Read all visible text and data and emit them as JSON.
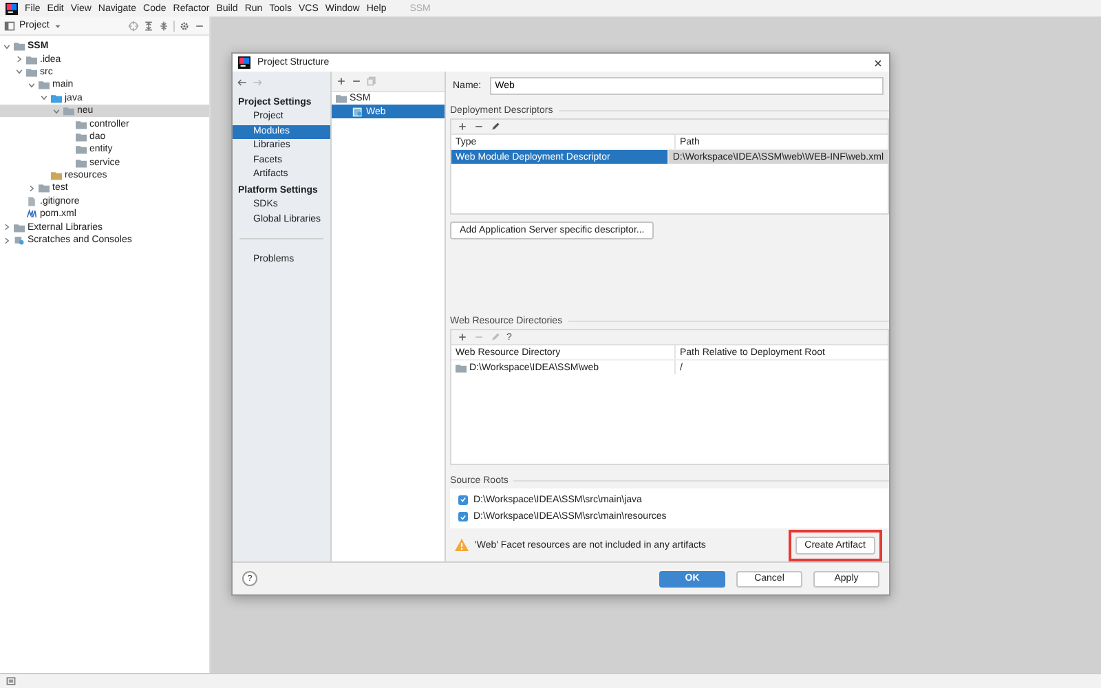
{
  "menu": [
    "File",
    "Edit",
    "View",
    "Navigate",
    "Code",
    "Refactor",
    "Build",
    "Run",
    "Tools",
    "VCS",
    "Window",
    "Help"
  ],
  "app_title": "SSM",
  "project_panel": {
    "title": "Project",
    "tree": [
      {
        "label": "SSM",
        "kind": "module",
        "bold": true,
        "expanded": true,
        "selected": false,
        "children": [
          {
            "label": ".idea",
            "kind": "folder",
            "expanded": false,
            "selected": false
          },
          {
            "label": "src",
            "kind": "folder",
            "expanded": true,
            "selected": false,
            "children": [
              {
                "label": "main",
                "kind": "folder",
                "expanded": true,
                "selected": false,
                "children": [
                  {
                    "label": "java",
                    "kind": "source",
                    "expanded": true,
                    "selected": false,
                    "children": [
                      {
                        "label": "neu",
                        "kind": "package",
                        "expanded": true,
                        "selected": true,
                        "children": [
                          {
                            "label": "controller",
                            "kind": "package",
                            "selected": false
                          },
                          {
                            "label": "dao",
                            "kind": "package",
                            "selected": false
                          },
                          {
                            "label": "entity",
                            "kind": "package",
                            "selected": false
                          },
                          {
                            "label": "service",
                            "kind": "package",
                            "selected": false
                          }
                        ]
                      }
                    ]
                  },
                  {
                    "label": "resources",
                    "kind": "resources",
                    "selected": false
                  }
                ]
              },
              {
                "label": "test",
                "kind": "folder",
                "expanded": false,
                "selected": false
              }
            ]
          },
          {
            "label": ".gitignore",
            "kind": "file",
            "selected": false
          },
          {
            "label": "pom.xml",
            "kind": "maven",
            "selected": false
          }
        ]
      },
      {
        "label": "External Libraries",
        "kind": "library",
        "expanded": false,
        "selected": false
      },
      {
        "label": "Scratches and Consoles",
        "kind": "scratch",
        "expanded": false,
        "selected": false
      }
    ]
  },
  "dialog": {
    "title": "Project Structure",
    "nav": [
      {
        "kind": "header",
        "label": "Project Settings"
      },
      {
        "kind": "item",
        "label": "Project",
        "selected": false
      },
      {
        "kind": "item",
        "label": "Modules",
        "selected": true
      },
      {
        "kind": "item",
        "label": "Libraries",
        "selected": false
      },
      {
        "kind": "item",
        "label": "Facets",
        "selected": false
      },
      {
        "kind": "item",
        "label": "Artifacts",
        "selected": false
      },
      {
        "kind": "header",
        "label": "Platform Settings"
      },
      {
        "kind": "item",
        "label": "SDKs",
        "selected": false
      },
      {
        "kind": "item",
        "label": "Global Libraries",
        "selected": false
      },
      {
        "kind": "divider"
      },
      {
        "kind": "item",
        "label": "Problems",
        "selected": false
      }
    ],
    "modules": [
      {
        "label": "SSM",
        "kind": "folder",
        "selected": false,
        "children": [
          {
            "label": "Web",
            "kind": "web",
            "selected": true
          }
        ]
      }
    ],
    "name_label": "Name:",
    "name_value": "Web",
    "deployment_descriptors": {
      "title": "Deployment Descriptors",
      "columns": [
        "Type",
        "Path"
      ],
      "rows": [
        {
          "cells": [
            "Web Module Deployment Descriptor",
            "D:\\Workspace\\IDEA\\SSM\\web\\WEB-INF\\web.xml"
          ],
          "selected": true
        }
      ],
      "button": "Add Application Server specific descriptor..."
    },
    "web_resource_directories": {
      "title": "Web Resource Directories",
      "toolbar_extra": "?",
      "columns": [
        "Web Resource Directory",
        "Path Relative to Deployment Root"
      ],
      "rows": [
        {
          "cells": [
            "D:\\Workspace\\IDEA\\SSM\\web",
            "/"
          ],
          "selected": false
        }
      ]
    },
    "source_roots": {
      "title": "Source Roots",
      "items": [
        {
          "label": "D:\\Workspace\\IDEA\\SSM\\src\\main\\java",
          "checked": true
        },
        {
          "label": "D:\\Workspace\\IDEA\\SSM\\src\\main\\resources",
          "checked": true
        }
      ]
    },
    "warning": "'Web' Facet resources are not included in any artifacts",
    "create_button": {
      "label": "Create Artifact",
      "highlighted": true
    },
    "help": "?",
    "buttons": [
      {
        "label": "OK",
        "primary": true
      },
      {
        "label": "Cancel",
        "primary": false
      },
      {
        "label": "Apply",
        "primary": false
      }
    ]
  }
}
